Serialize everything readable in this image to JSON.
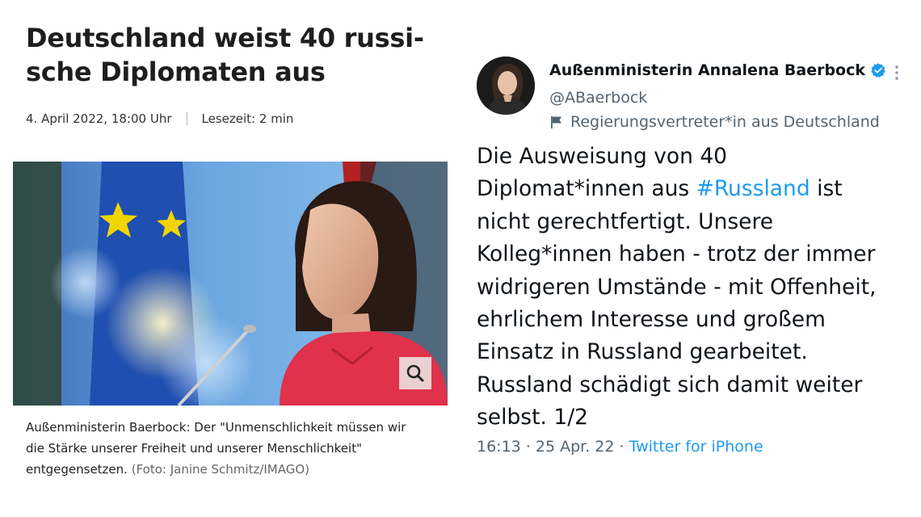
{
  "article": {
    "headline_line1": "Deutschland weist 40 russi-",
    "headline_line2": "sche Diplomaten aus",
    "date": "4. April 2022, 18:00 Uhr",
    "read_time": "Lesezeit: 2 min",
    "caption_line1": "Außenministerin Baerbock: Der \"Unmenschlichkeit müssen wir",
    "caption_line2": "die Stärke unserer Freiheit und unserer Menschlichkeit\"",
    "caption_line3": "entgegensetzen.",
    "photo_credit": "(Foto: Janine Schmitz/IMAGO)",
    "zoom_icon": "magnifier-icon"
  },
  "tweet": {
    "author_name": "Außenministerin Annalena Baerbock",
    "handle": "@ABaerbock",
    "label": "Regierungsvertreter*in aus Deutschland",
    "text_line1": "Die Ausweisung von 40",
    "text_line2_prefix": "Diplomat*innen aus ",
    "hashtag": "#Russland",
    "text_line2_suffix": " ist",
    "text_line3": "nicht gerechtfertigt. Unsere",
    "text_line4": "Kolleg*innen haben - trotz der immer",
    "text_line5": "widrigeren Umstände - mit Offenheit,",
    "text_line6": "ehrlichem Interesse und großem",
    "text_line7": "Einsatz in Russland gearbeitet.",
    "text_line8": "Russland schädigt sich damit weiter",
    "text_line9": "selbst. 1/2",
    "time": "16:13",
    "date": "25 Apr. 22",
    "source": "Twitter for iPhone",
    "separator": " · "
  },
  "colors": {
    "link_blue": "#1d9bf0",
    "muted_gray": "#536471",
    "text_dark": "#0f1419",
    "blazer_red": "#e0324a",
    "eu_blue": "#1f4fb0",
    "eu_star": "#f2d500"
  }
}
